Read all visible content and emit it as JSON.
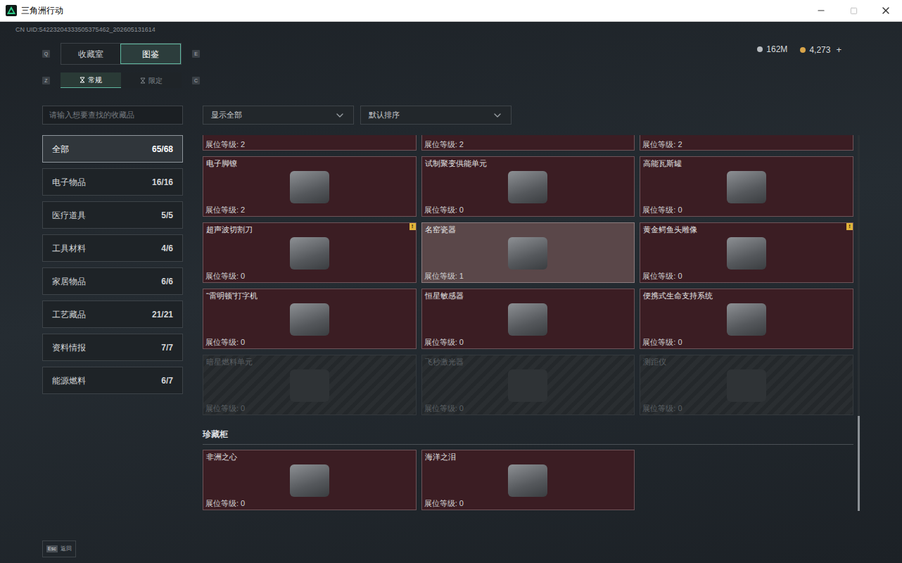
{
  "window": {
    "title": "三角洲行动"
  },
  "header": {
    "uid": "CN UID:54223204333505375462_202605131614",
    "currency": [
      {
        "value": "162M"
      },
      {
        "value": "4,273"
      }
    ],
    "add": "+"
  },
  "tabs": [
    {
      "label": "收藏室",
      "selected": false
    },
    {
      "label": "图鉴",
      "selected": true
    }
  ],
  "tab_keys": [
    "Q",
    "E"
  ],
  "subtabs": [
    {
      "label": "常规",
      "selected": true
    },
    {
      "label": "限定",
      "selected": false
    }
  ],
  "subtab_keys": [
    "Z",
    "C"
  ],
  "search": {
    "placeholder": "请输入想要查找的收藏品"
  },
  "filters": [
    {
      "label": "显示全部"
    },
    {
      "label": "默认排序"
    }
  ],
  "sidebar": {
    "items": [
      {
        "label": "全部",
        "count": "65/68",
        "selected": true
      },
      {
        "label": "电子物品",
        "count": "16/16",
        "selected": false
      },
      {
        "label": "医疗道具",
        "count": "5/5",
        "selected": false
      },
      {
        "label": "工具材料",
        "count": "4/6",
        "selected": false
      },
      {
        "label": "家居物品",
        "count": "6/6",
        "selected": false
      },
      {
        "label": "工艺藏品",
        "count": "21/21",
        "selected": false
      },
      {
        "label": "资料情报",
        "count": "7/7",
        "selected": false
      },
      {
        "label": "能源燃料",
        "count": "6/7",
        "selected": false
      }
    ]
  },
  "grid": {
    "badge": "!",
    "partial_row": [
      {
        "level": "展位等级: 2"
      },
      {
        "level": "展位等级: 2"
      },
      {
        "level": "展位等级: 2"
      }
    ],
    "items": [
      {
        "name": "电子脚镣",
        "level": "展位等级: 2",
        "selected": false,
        "locked": false,
        "alert": false
      },
      {
        "name": "试制聚变供能单元",
        "level": "展位等级: 0",
        "selected": false,
        "locked": false,
        "alert": false
      },
      {
        "name": "高能瓦斯罐",
        "level": "展位等级: 0",
        "selected": false,
        "locked": false,
        "alert": false
      },
      {
        "name": "超声波切割刀",
        "level": "展位等级: 0",
        "selected": false,
        "locked": false,
        "alert": true
      },
      {
        "name": "名窑瓷器",
        "level": "展位等级: 1",
        "selected": true,
        "locked": false,
        "alert": false
      },
      {
        "name": "黄金鳄鱼头雕像",
        "level": "展位等级: 0",
        "selected": false,
        "locked": false,
        "alert": true
      },
      {
        "name": "“雷明顿”打字机",
        "level": "展位等级: 0",
        "selected": false,
        "locked": false,
        "alert": false
      },
      {
        "name": "恒星敏感器",
        "level": "展位等级: 0",
        "selected": false,
        "locked": false,
        "alert": false
      },
      {
        "name": "便携式生命支持系统",
        "level": "展位等级: 0",
        "selected": false,
        "locked": false,
        "alert": false
      },
      {
        "name": "暗星燃料单元",
        "level": "展位等级: 0",
        "selected": false,
        "locked": true,
        "alert": false
      },
      {
        "name": "飞秒激光器",
        "level": "展位等级: 0",
        "selected": false,
        "locked": true,
        "alert": false
      },
      {
        "name": "测距仪",
        "level": "展位等级: 0",
        "selected": false,
        "locked": true,
        "alert": false
      }
    ]
  },
  "showcase": {
    "title": "珍藏柜",
    "items": [
      {
        "name": "非洲之心",
        "level": "展位等级: 0",
        "selected": false,
        "locked": false,
        "alert": false
      },
      {
        "name": "海洋之泪",
        "level": "展位等级: 0",
        "selected": false,
        "locked": false,
        "alert": false
      }
    ]
  },
  "footer": {
    "key": "Esc",
    "label": "返回"
  }
}
